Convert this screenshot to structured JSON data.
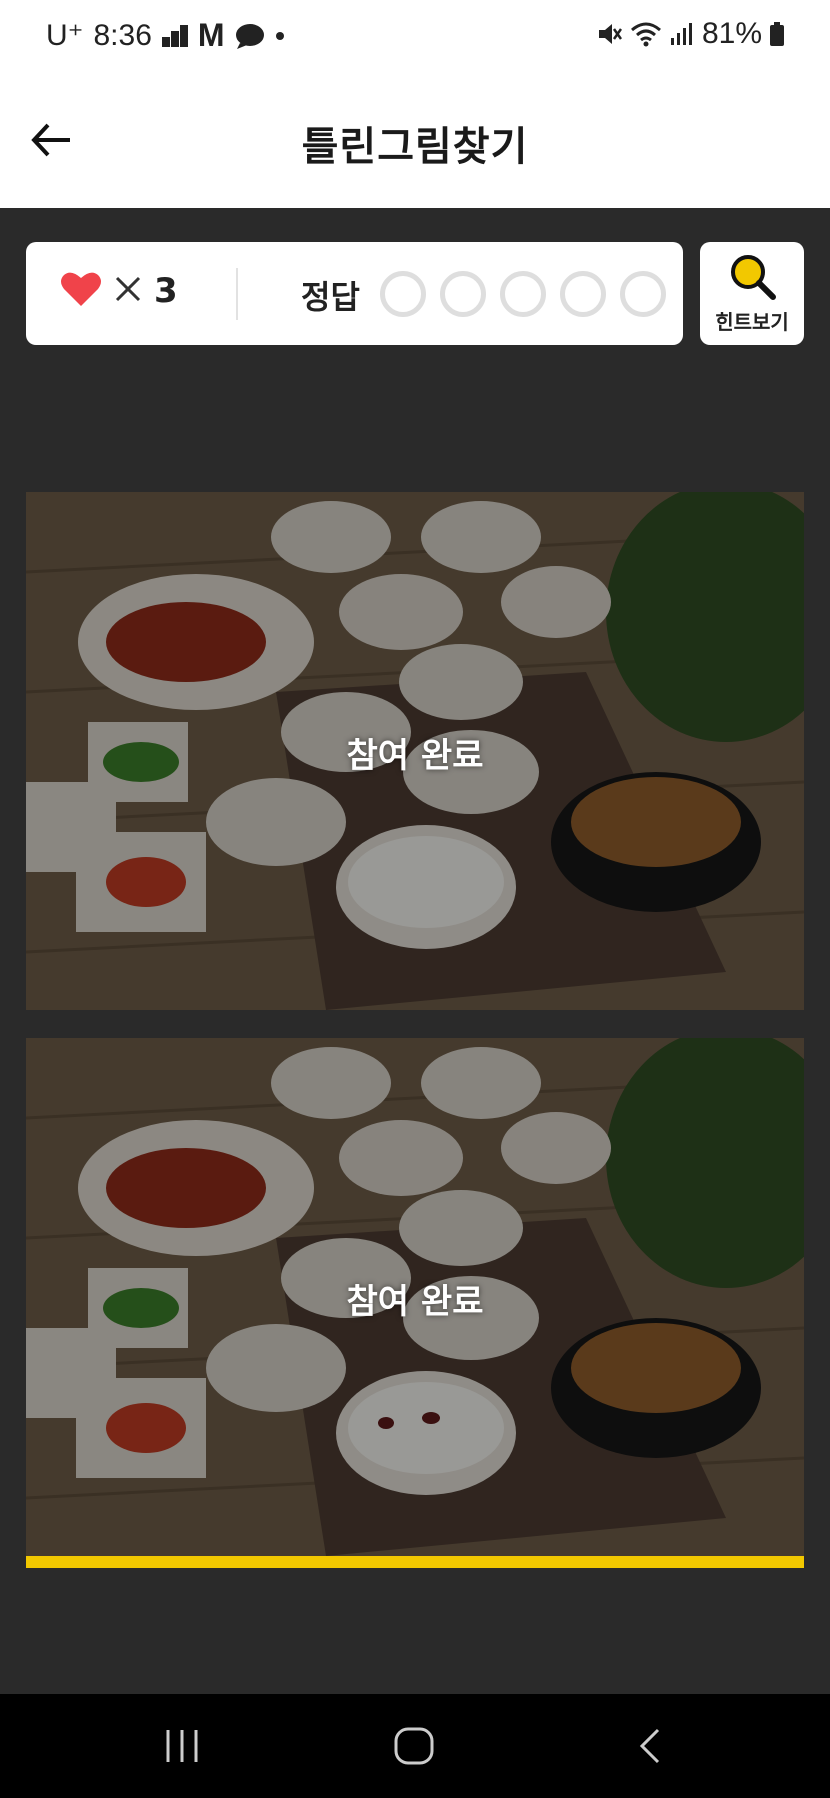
{
  "status_bar": {
    "carrier": "U⁺",
    "time": "8:36",
    "battery": "81%"
  },
  "header": {
    "title": "틀린그림찾기"
  },
  "score_card": {
    "lives_count": "3",
    "answer_label": "정답",
    "answers_found": 0,
    "answers_total": 5
  },
  "hint": {
    "label": "힌트보기"
  },
  "images": [
    {
      "overlay_text": "참여 완료"
    },
    {
      "overlay_text": "참여 완료"
    }
  ],
  "colors": {
    "accent": "#f2c800",
    "heart": "#f0434a",
    "background": "#2a2a2a"
  },
  "icons": [
    "back-arrow-icon",
    "heart-icon",
    "times-icon",
    "search-icon",
    "recent-apps-icon",
    "home-icon",
    "back-icon"
  ]
}
